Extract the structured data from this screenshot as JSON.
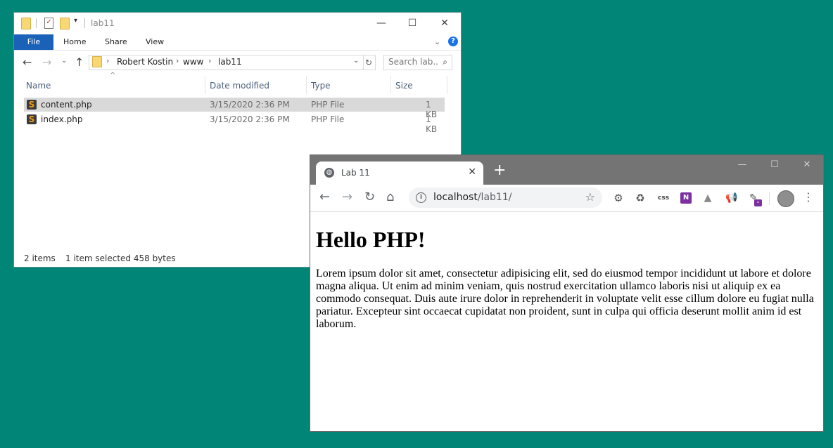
{
  "explorer": {
    "title": "lab11",
    "ribbon": {
      "file": "File",
      "home": "Home",
      "share": "Share",
      "view": "View"
    },
    "breadcrumb": [
      "Robert Kostin",
      "www",
      "lab11"
    ],
    "search_placeholder": "Search lab...",
    "columns": {
      "name": "Name",
      "date": "Date modified",
      "type": "Type",
      "size": "Size"
    },
    "files": [
      {
        "name": "content.php",
        "date": "3/15/2020 2:36 PM",
        "type": "PHP File",
        "size": "1 KB",
        "selected": true
      },
      {
        "name": "index.php",
        "date": "3/15/2020 2:36 PM",
        "type": "PHP File",
        "size": "1 KB",
        "selected": false
      }
    ],
    "status": {
      "items": "2 items",
      "selection": "1 item selected  458 bytes"
    }
  },
  "browser": {
    "tab_title": "Lab 11",
    "url_host": "localhost",
    "url_path": "/lab11/",
    "extensions": [
      "settings-gear-icon",
      "recycle-icon",
      "css-icon",
      "onenote-icon",
      "drive-icon",
      "megaphone-icon",
      "eyedropper-icon"
    ],
    "ext_css_label": "css",
    "page": {
      "heading": "Hello PHP!",
      "paragraph": "Lorem ipsum dolor sit amet, consectetur adipisicing elit, sed do eiusmod tempor incididunt ut labore et dolore magna aliqua. Ut enim ad minim veniam, quis nostrud exercitation ullamco laboris nisi ut aliquip ex ea commodo consequat. Duis aute irure dolor in reprehenderit in voluptate velit esse cillum dolore eu fugiat nulla pariatur. Excepteur sint occaecat cupidatat non proident, sunt in culpa qui officia deserunt mollit anim id est laborum."
    }
  },
  "colors": {
    "desktop": "#008577",
    "ribbon_file": "#1a62b8",
    "selection": "#d9d9d9",
    "chrome_frame": "#747474"
  }
}
